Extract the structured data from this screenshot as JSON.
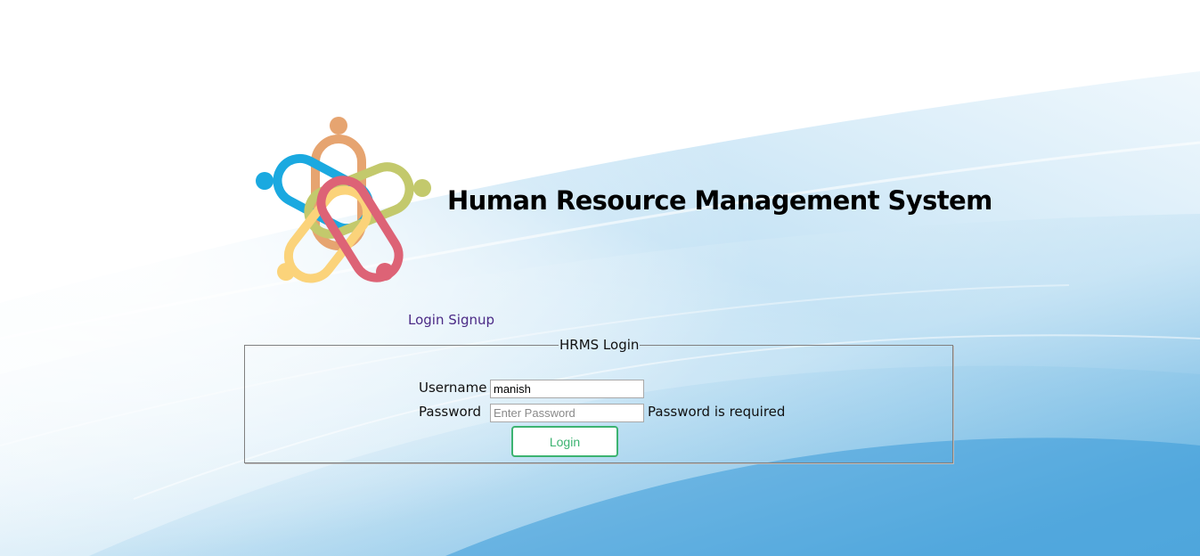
{
  "header": {
    "title": "Human Resource Management System"
  },
  "nav": {
    "login_link": "Login",
    "signup_link": "Signup"
  },
  "login_form": {
    "legend": "HRMS Login",
    "username_label": "Username",
    "username_value": "manish",
    "password_label": "Password",
    "password_value": "",
    "password_placeholder": "Enter Password",
    "password_error": "Password is required",
    "submit_label": "Login"
  },
  "icons": {
    "logo": "people-chain-logo-icon"
  },
  "colors": {
    "button_accent": "#3cb371",
    "link": "#4b2a86",
    "logo_orange": "#e6a470",
    "logo_blue": "#1aa9e0",
    "logo_green": "#c3c96c",
    "logo_yellow": "#fbd37a",
    "logo_red": "#dd6376"
  }
}
